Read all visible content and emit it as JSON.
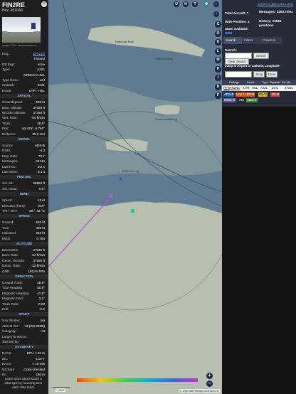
{
  "info": {
    "callsign": "FIN2RE",
    "hex_line": "Hex: 461FA8",
    "photo_credit": "Image © Rob Vanmarssenhove",
    "close_glyph": "×",
    "rows_top": [
      {
        "k": "Reg.:",
        "v": "OH-LZS",
        "link": true
      },
      {
        "k": "",
        "v": "Finland",
        "link": false
      },
      {
        "k": "DB flags:",
        "v": "none",
        "link": false
      },
      {
        "k": "Type:",
        "v": "A321",
        "link": false
      },
      {
        "k": "",
        "v": "AIRBUS A-321",
        "link": false
      },
      {
        "k": "Type Desc.:",
        "v": "L2J",
        "link": false
      },
      {
        "k": "Squawk:",
        "v": "2041",
        "link": false
      },
      {
        "k": "Route:",
        "v": "LHR - HEL",
        "link": false
      }
    ],
    "sections": [
      {
        "title": "SPATIAL",
        "rows": [
          {
            "k": "Groundspeed:",
            "v": "503 kt"
          },
          {
            "k": "Baro. altitude:",
            "v": "37025 ft"
          },
          {
            "k": "WGS84 altitude:",
            "v": "37150 ft"
          },
          {
            "k": "Vert. Rate:",
            "v": "-64 ft/min"
          },
          {
            "k": "Track:",
            "v": "48.9°"
          },
          {
            "k": "Pos.:",
            "v": "53.479°, 6.765°"
          },
          {
            "k": "Distance:",
            "v": "35.0 nmi"
          }
        ]
      },
      {
        "title": "SIGNAL",
        "rows": [
          {
            "k": "Source:",
            "v": "ADS-B"
          },
          {
            "k": "RSSI:",
            "v": "-4.3"
          },
          {
            "k": "Msg. Rate:",
            "v": "70.7"
          },
          {
            "k": "Messages:",
            "v": "53144"
          },
          {
            "k": "Last Pos.:",
            "v": "0.2 s"
          },
          {
            "k": "Last Seen:",
            "v": "0.1 s"
          }
        ]
      },
      {
        "title": "FMS SEL",
        "rows": [
          {
            "k": "Sel. Alt.:",
            "v": "36992 ft"
          },
          {
            "k": "Sel. Head.:",
            "v": "0.0°"
          }
        ]
      },
      {
        "title": "WIND",
        "rows": [
          {
            "k": "Speed:",
            "v": "46 kt"
          },
          {
            "k": "Direction (from):",
            "v": "218°"
          },
          {
            "k": "TAT / OAT:",
            "v": "-19 / -46 °C"
          }
        ]
      },
      {
        "title": "SPEED",
        "rows": [
          {
            "k": "Ground:",
            "v": "503 kt"
          },
          {
            "k": "True:",
            "v": "460 kt"
          },
          {
            "k": "Indicated:",
            "v": "253 kt"
          },
          {
            "k": "Mach:",
            "v": "0.784"
          }
        ]
      },
      {
        "title": "ALTITUDE",
        "rows": [
          {
            "k": "Barometric:",
            "v": "37025 ft"
          },
          {
            "k": "Baro. Rate:",
            "v": "-64 ft/min"
          },
          {
            "k": "Geom. WGS84:",
            "v": "37150 ft"
          },
          {
            "k": "Geom. Rate:",
            "v": "-32 ft/min"
          },
          {
            "k": "QNH:",
            "v": "1013.6 hPa"
          }
        ]
      },
      {
        "title": "DIRECTION",
        "rows": [
          {
            "k": "Ground Track:",
            "v": "48.9°"
          },
          {
            "k": "True Heading:",
            "v": "50.9°"
          },
          {
            "k": "Magnetic Heading:",
            "v": "47.8°"
          },
          {
            "k": "Magnetic Decl.:",
            "v": "3.1°"
          },
          {
            "k": "Track Rate:",
            "v": "0.00"
          },
          {
            "k": "Roll:",
            "v": "-0.2"
          }
        ]
      },
      {
        "title": "STUFF",
        "rows": [
          {
            "k": "Nav. Modes:",
            "v": "n/a"
          },
          {
            "k": "ADS-B Ver.:",
            "v": "v2 (DO-260B)"
          },
          {
            "k": "Category:",
            "v": "A3"
          },
          {
            "k": "Large (75 000 to",
            "v": ""
          },
          {
            "k": "300 000 lb)",
            "v": ""
          }
        ]
      },
      {
        "title": "ACCURACY",
        "rows": [
          {
            "k": "NACp:",
            "v": "EPU < 30 m"
          },
          {
            "k": "SIL:",
            "v": "≤ 1e-7"
          },
          {
            "k": "NACv:",
            "v": "< 10 m/s"
          },
          {
            "k": "NICbaro:",
            "v": "cross-checked"
          },
          {
            "k": "Rc:",
            "v": "186 m"
          }
        ]
      }
    ],
    "footer": "Learn more about Mode S data type by hovering over each data label."
  },
  "map": {
    "top_buttons": [
      "U",
      "H",
      "T"
    ],
    "side_buttons": [
      "C",
      "O",
      "K",
      "L",
      "M",
      "P",
      "I",
      "R",
      "F"
    ],
    "zoom_in": "+",
    "zoom_out": "−",
    "labels": [
      "Nationaal Park",
      "Schiermonnikoog",
      "Rottumeroog",
      "Rottumerplaat"
    ],
    "scale_label": "1 NM",
    "attribution": "© OpenStreetMap contributors.",
    "colors": {
      "water": "#5f7a91",
      "land": "#b6bfb0",
      "track": "#b44fd6",
      "aircraft": "#c05ce0"
    }
  },
  "right": {
    "version_link": "tar1090 on github (3.14.1701)",
    "total_aircraft": "Total Aircraft: 1",
    "with_position": "With Position: 1",
    "stats_label": "Stats available",
    "messages": "Messages: 1293.7/sec",
    "history": "History: 20584 positions",
    "tabs": [
      "Search",
      "Filters",
      "Columns"
    ],
    "search_label": "Search:",
    "search_button": "Search",
    "clear_search_button": "Clear Search",
    "jump_label": "Jump to Airport or Latitude, Longitude:",
    "jump_button": "Jump",
    "clear_button": "Clear",
    "table_headers": [
      "Callsign",
      "Route",
      "Type",
      "Squawk",
      "Alt. (ft)"
    ],
    "table_row": [
      "FIN2RE",
      "LHR - HEL",
      "A321",
      "2041",
      "37025"
    ],
    "sources": [
      {
        "label": "ADS-B",
        "color": "#1f5fa0",
        "text": "#ffffff"
      },
      {
        "label": "UAT / ADS-R",
        "color": "#d4581e",
        "text": "#ffffff"
      },
      {
        "label": "MLAT",
        "color": "#d8b63c",
        "text": "#222222"
      },
      {
        "label": "TIS-B",
        "color": "#c44545",
        "text": "#ffffff"
      },
      {
        "label": "Mode-S",
        "color": "#5b5b9a",
        "text": "#ffffff"
      },
      {
        "label": "AIS",
        "color": "#2d2d2d",
        "text": "#ffffff"
      },
      {
        "label": "ADS-C",
        "color": "#3c8a3c",
        "text": "#ffffff"
      }
    ]
  }
}
